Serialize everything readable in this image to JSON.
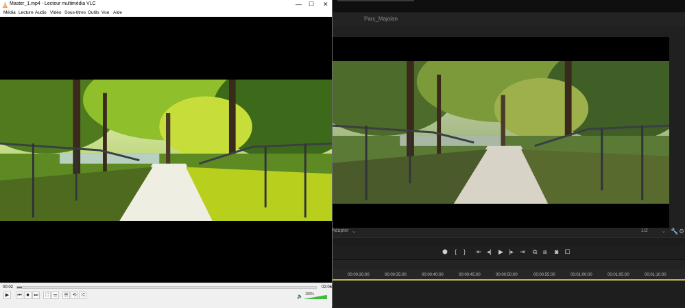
{
  "editor": {
    "sequence_name": "Parc_Majolan",
    "fit_select": "Adapter",
    "resolution_select": "1/2",
    "transport": {
      "mark_marker": "⬢",
      "mark_in": "{",
      "mark_out": "}",
      "go_to_in": "⇤",
      "step_back": "◂|",
      "play": "▶",
      "step_forward": "|▸",
      "go_to_out": "⇥",
      "lift": "⧉",
      "extract": "⧈",
      "export_frame": "◙",
      "compare": "⧠"
    },
    "timecodes": [
      "00:00:30:00",
      "00:00:35:00",
      "00:00:40:00",
      "00:00:45:00",
      "00:00:50:00",
      "00:00:55:00",
      "00:01:00:00",
      "00:01:05:00",
      "00:01:10:00"
    ]
  },
  "vlc": {
    "window_title": "Master_1.mp4 - Lecteur multimédia VLC",
    "window_buttons": {
      "minimize": "—",
      "maximize": "☐",
      "close": "✕"
    },
    "menu": [
      {
        "label": "Média"
      },
      {
        "label": "Lecture"
      },
      {
        "label": "Audio"
      },
      {
        "label": "Vidéo"
      },
      {
        "label": "Sous-titres"
      },
      {
        "label": "Outils"
      },
      {
        "label": "Vue"
      },
      {
        "label": "Aide"
      }
    ],
    "time_elapsed": "00:02",
    "time_total": "02:06",
    "progress": 0.016,
    "volume_label": "100%",
    "volume": 1.0,
    "buttons": {
      "play": "▶",
      "prev": "⏮",
      "stop": "■",
      "next": "⏭",
      "fullscreen": "⛶",
      "extended": "⚌",
      "playlist": "☰",
      "loop": "⟲",
      "random": "⤮"
    }
  },
  "colors": {
    "vlc_progress": "#2a7be0",
    "volume_green": "#3dbd3d",
    "timeline_playhead": "#c9b64a"
  }
}
